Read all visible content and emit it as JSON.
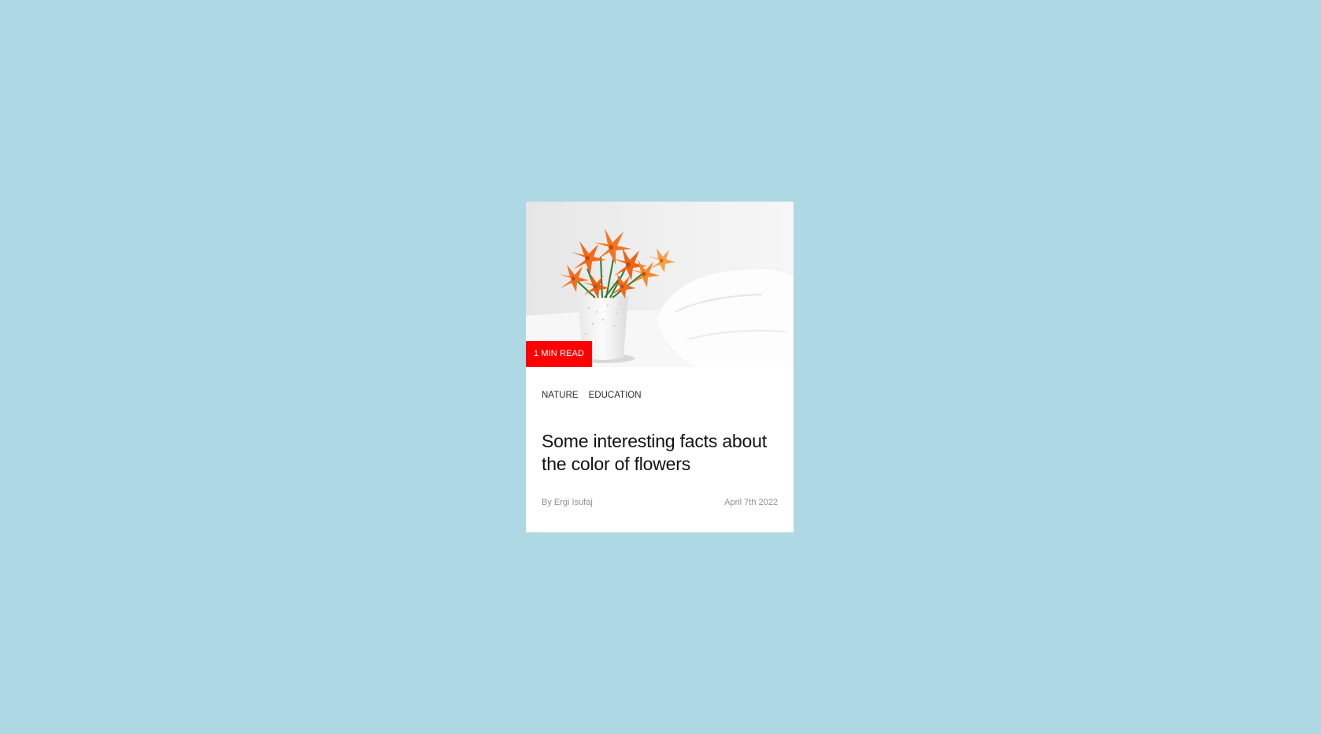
{
  "card": {
    "badge": "1 MIN READ",
    "tags": [
      "NATURE",
      "EDUCATION"
    ],
    "title": "Some interesting facts about the color of flowers",
    "author": "By Ergi Isufaj",
    "date": "April 7th 2022"
  },
  "colors": {
    "page_background": "#add8e4",
    "card_background": "#ffffff",
    "badge_background": "#ff0000",
    "flower_orange": "#f26a1b"
  }
}
